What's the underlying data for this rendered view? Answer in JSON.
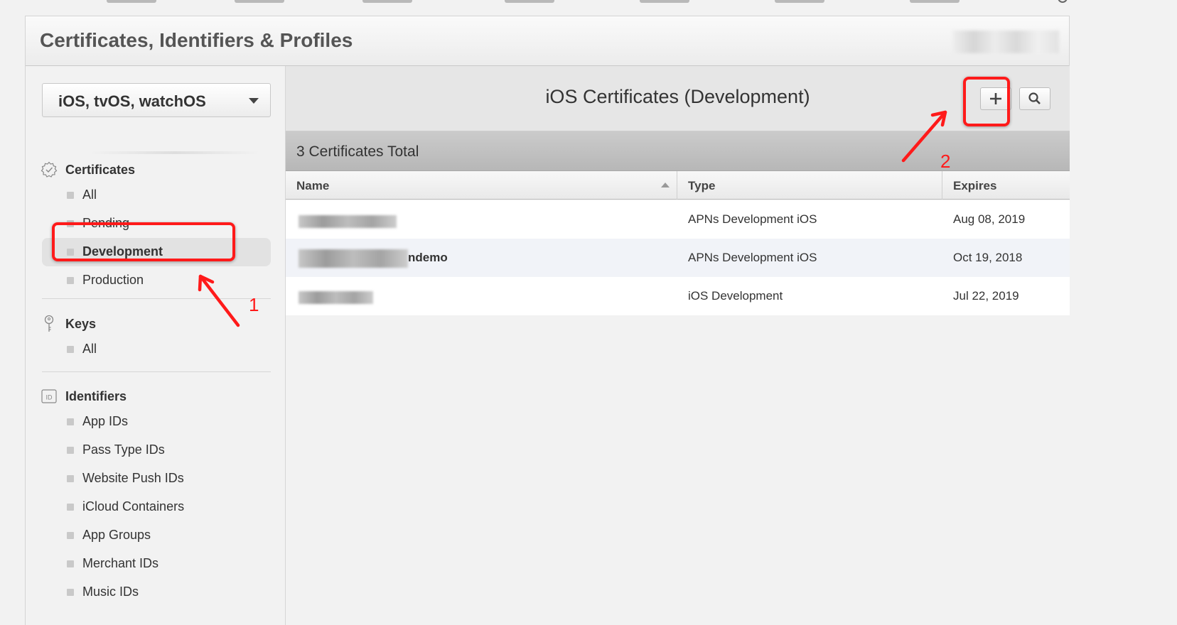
{
  "header": {
    "title": "Certificates, Identifiers & Profiles"
  },
  "sidebar": {
    "platform": "iOS, tvOS, watchOS",
    "sections": {
      "certificates": {
        "title": "Certificates",
        "items": [
          "All",
          "Pending",
          "Development",
          "Production"
        ]
      },
      "keys": {
        "title": "Keys",
        "items": [
          "All"
        ]
      },
      "identifiers": {
        "title": "Identifiers",
        "badge": "ID",
        "items": [
          "App IDs",
          "Pass Type IDs",
          "Website Push IDs",
          "iCloud Containers",
          "App Groups",
          "Merchant IDs",
          "Music IDs"
        ]
      }
    },
    "active_item": "Development"
  },
  "main": {
    "title": "iOS Certificates (Development)",
    "total": "3 Certificates Total",
    "columns": [
      "Name",
      "Type",
      "Expires"
    ],
    "rows": [
      {
        "name_visible": "",
        "type": "APNs Development iOS",
        "expires": "Aug 08, 2019"
      },
      {
        "name_visible": "ndemo",
        "type": "APNs Development iOS",
        "expires": "Oct 19, 2018"
      },
      {
        "name_visible": "",
        "type": "iOS Development",
        "expires": "Jul 22, 2019"
      }
    ]
  },
  "annotations": {
    "step1": "1",
    "step2": "2"
  },
  "colors": {
    "annotation": "#ff1a1a",
    "active_item_bg": "#e2e2e2",
    "alt_row_bg": "#f1f3f8"
  }
}
